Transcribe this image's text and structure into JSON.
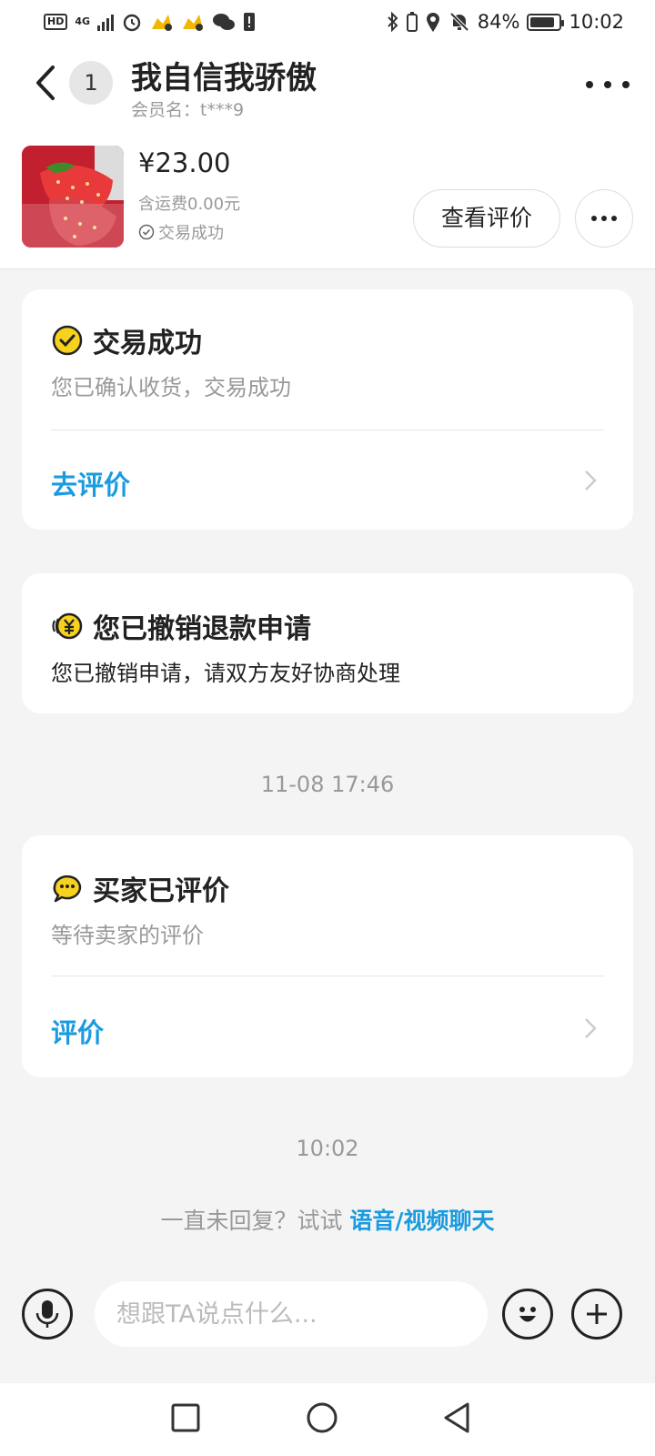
{
  "status_bar": {
    "network_label": "HD",
    "network_type": "4G",
    "battery_percent": "84%",
    "battery_level": 0.84,
    "time": "10:02",
    "icons": [
      "hd-icon",
      "signal-icon",
      "alarm-icon",
      "app-icon",
      "app-icon",
      "wechat-icon",
      "notification-icon",
      "bluetooth-icon",
      "location-icon",
      "mute-icon",
      "battery-icon"
    ]
  },
  "header": {
    "unread_count": "1",
    "chat_name": "我自信我骄傲",
    "member_line": "会员名：t***9"
  },
  "product": {
    "price": "¥23.00",
    "shipping": "含运费0.00元",
    "status": "交易成功",
    "review_button": "查看评价"
  },
  "cards": {
    "deal_success": {
      "title": "交易成功",
      "subtitle": "您已确认收货，交易成功",
      "action": "去评价"
    },
    "refund_cancelled": {
      "title": "您已撤销退款申请",
      "subtitle": "您已撤销申请，请双方友好协商处理"
    },
    "buyer_reviewed": {
      "title": "买家已评价",
      "subtitle": "等待卖家的评价",
      "action": "评价"
    }
  },
  "timestamps": {
    "first": "11-08 17:46",
    "second": "10:02"
  },
  "hint": {
    "text": "一直未回复？试试",
    "link": "语音/视频聊天"
  },
  "input": {
    "placeholder": "想跟TA说点什么..."
  },
  "colors": {
    "accent": "#1a9bdf",
    "success_yellow": "#f6d21e",
    "background": "#f4f4f4"
  }
}
